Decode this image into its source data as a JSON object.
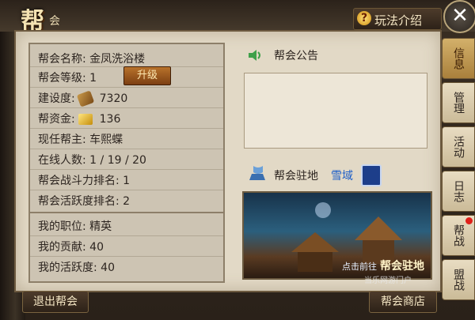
{
  "header": {
    "title_char": "帮",
    "title_sub": "会",
    "help_label": "玩法介绍",
    "close_symbol": "✕"
  },
  "info": {
    "guild_name": "帮会名称: 金凤洗浴楼",
    "guild_level": "帮会等级: 1",
    "upgrade_label": "升级",
    "construction_label": "建设度:",
    "construction_value": "7320",
    "funds_label": "帮资金:",
    "funds_value": "136",
    "leader": "现任帮主: 车熙蝶",
    "online": "在线人数: 1 / 19 / 20",
    "war_rank": "帮会战斗力排名: 1",
    "activity_rank": "帮会活跃度排名: 2"
  },
  "my": {
    "position": "我的职位: 精英",
    "contribution": "我的贡献: 40",
    "activity": "我的活跃度: 40"
  },
  "announcement": {
    "title": "帮会公告"
  },
  "base": {
    "title": "帮会驻地",
    "location": "雪域",
    "goto_prefix": "点击前往",
    "goto_label": "帮会驻地"
  },
  "tabs": [
    {
      "label": "信息",
      "active": true
    },
    {
      "label": "管理",
      "active": false
    },
    {
      "label": "活动",
      "active": false
    },
    {
      "label": "日志",
      "active": false
    },
    {
      "label": "帮战",
      "active": false,
      "notify": true
    },
    {
      "label": "盟战",
      "active": false
    }
  ],
  "buttons": {
    "exit": "退出帮会",
    "shop": "帮会商店"
  },
  "watermark": "当乐网游门户"
}
